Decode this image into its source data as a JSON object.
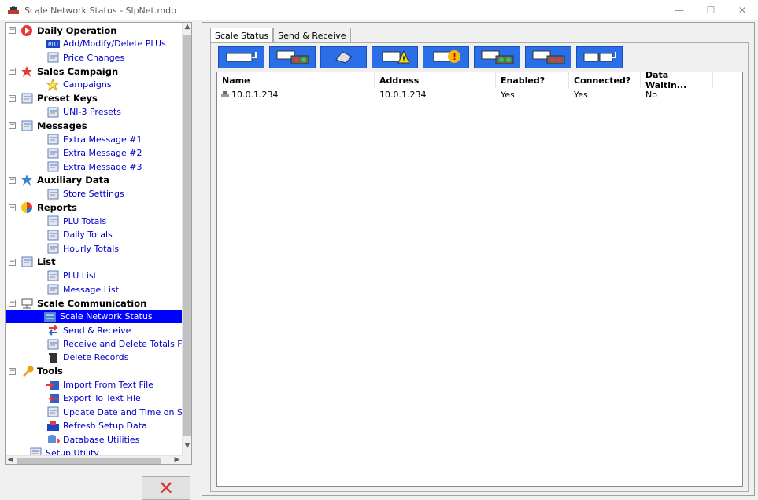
{
  "window": {
    "title": "Scale Network Status - SlpNet.mdb",
    "minimize": "—",
    "maximize": "☐",
    "close": "✕"
  },
  "tree": {
    "groups": [
      {
        "label": "Daily Operation",
        "icon": "daily-operation-icon",
        "children": [
          {
            "label": "Add/Modify/Delete PLUs",
            "icon": "plu-icon"
          },
          {
            "label": "Price Changes",
            "icon": "price-changes-icon"
          }
        ]
      },
      {
        "label": "Sales Campaign",
        "icon": "star-icon",
        "children": [
          {
            "label": "Campaigns",
            "icon": "campaign-star-icon"
          }
        ]
      },
      {
        "label": "Preset Keys",
        "icon": "keyboard-icon",
        "children": [
          {
            "label": "UNI-3 Presets",
            "icon": "uni3-icon"
          }
        ]
      },
      {
        "label": "Messages",
        "icon": "messages-icon",
        "children": [
          {
            "label": "Extra Message #1",
            "icon": "message-icon"
          },
          {
            "label": "Extra Message #2",
            "icon": "message-icon"
          },
          {
            "label": "Extra Message #3",
            "icon": "message-icon"
          }
        ]
      },
      {
        "label": "Auxiliary Data",
        "icon": "auxiliary-star-icon",
        "children": [
          {
            "label": "Store Settings",
            "icon": "store-settings-icon"
          }
        ]
      },
      {
        "label": "Reports",
        "icon": "pie-chart-icon",
        "children": [
          {
            "label": "PLU Totals",
            "icon": "bar-chart-icon"
          },
          {
            "label": "Daily Totals",
            "icon": "daily-totals-icon"
          },
          {
            "label": "Hourly Totals",
            "icon": "hourly-totals-icon"
          }
        ]
      },
      {
        "label": "List",
        "icon": "list-icon",
        "children": [
          {
            "label": "PLU List",
            "icon": "plu-list-icon"
          },
          {
            "label": "Message List",
            "icon": "message-list-icon"
          }
        ]
      },
      {
        "label": "Scale Communication",
        "icon": "network-icon",
        "children": [
          {
            "label": "Scale Network Status",
            "icon": "network-status-icon",
            "selected": true
          },
          {
            "label": "Send & Receive",
            "icon": "send-receive-icon"
          },
          {
            "label": "Receive and Delete Totals F",
            "icon": "receive-delete-icon"
          },
          {
            "label": "Delete Records",
            "icon": "trash-icon"
          }
        ]
      },
      {
        "label": "Tools",
        "icon": "tools-icon",
        "children": [
          {
            "label": "Import From Text File",
            "icon": "import-icon"
          },
          {
            "label": "Export To Text File",
            "icon": "export-icon"
          },
          {
            "label": "Update Date and Time on S",
            "icon": "date-time-icon"
          },
          {
            "label": "Refresh Setup Data",
            "icon": "refresh-icon"
          },
          {
            "label": "Database Utilities",
            "icon": "database-icon"
          }
        ]
      }
    ],
    "extra": {
      "label": "Setup Utility",
      "icon": "setup-utility-icon"
    }
  },
  "tabs": [
    {
      "label": "Scale Status",
      "active": true
    },
    {
      "label": "Send & Receive",
      "active": false
    }
  ],
  "toolbar": [
    {
      "name": "scale-connect-button",
      "icon": "scale-plug-icon"
    },
    {
      "name": "scale-status-lights-button",
      "icon": "status-lights-icon"
    },
    {
      "name": "erase-button",
      "icon": "eraser-icon"
    },
    {
      "name": "warning-button",
      "icon": "warning-icon"
    },
    {
      "name": "alert-button",
      "icon": "alert-icon"
    },
    {
      "name": "scale-green-button",
      "icon": "scale-green-icon"
    },
    {
      "name": "scale-red-button",
      "icon": "scale-red-icon"
    },
    {
      "name": "scale-disconnect-button",
      "icon": "scale-unplug-icon"
    }
  ],
  "list": {
    "columns": [
      "Name",
      "Address",
      "Enabled?",
      "Connected?",
      "Data Waitin..."
    ],
    "rows": [
      [
        "10.0.1.234",
        "10.0.1.234",
        "Yes",
        "Yes",
        "No"
      ]
    ]
  },
  "close_button": "✕",
  "colors": {
    "selection": "#0000ff",
    "link": "#0000cc",
    "toolbar": "#2a6fe8"
  }
}
